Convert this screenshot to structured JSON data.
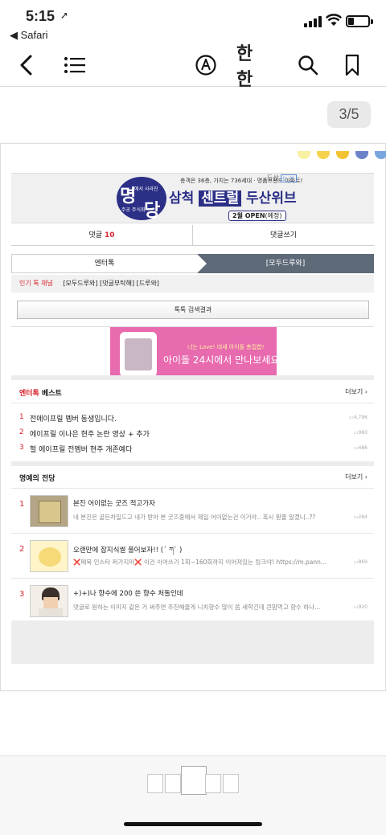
{
  "status_bar": {
    "time": "5:15",
    "back_app": "◀ Safari",
    "battery_percent": 25
  },
  "toolbar": {
    "reader_text": "한한"
  },
  "viewer": {
    "page_indicator": "3/5"
  },
  "ad": {
    "logo_big1": "명",
    "logo_big2": "당",
    "logo_small1": "에서 사라진",
    "logo_small2": "주공 주식회",
    "subtitle": "총객은 36층, 가치는 736세대 · 명품브랜드 아파트!",
    "title_pre": "삼척 ",
    "title_highlight": "센트럴",
    "title_post": " 두산위브",
    "open_badge": "2월 OPEN",
    "open_badge_note": "(예정)",
    "ad_mark": "두산"
  },
  "comment_tabs": {
    "comments_label": "댓글",
    "comments_count": "10",
    "write_comment": "댓글쓰기"
  },
  "category_tabs": {
    "left": "엔터톡",
    "right": "[모두드루와]"
  },
  "hot_channel": {
    "label": "인기 톡 채널",
    "channels": "[모두드루와] [댓글부탁해] [드루와]"
  },
  "search_results_button": "톡톡 검색결과",
  "promo": {
    "line1": "너는 Love! 대세 아이돌 총집합!",
    "line2": "아이돌 24시에서 만나보세요!"
  },
  "entertalk_best": {
    "title_red": "엔터톡",
    "title_rest": " 베스트",
    "more": "더보기 ›",
    "items": [
      {
        "num": "1",
        "text": "전에이프릴 멤버 동생입니다.",
        "comments": "4,796"
      },
      {
        "num": "2",
        "text": "에이프릴 이나은 현주 논란 영상 + 추가",
        "comments": "960"
      },
      {
        "num": "3",
        "text": "헐 에이프릴 전멤버 현주 개존예다",
        "comments": "486"
      }
    ]
  },
  "hall_of_fame": {
    "title": "명예의 전당",
    "more": "더보기 ›",
    "items": [
      {
        "num": "1",
        "title": "본진 어이없는 굿즈 적고가자",
        "desc": "내 본진은 골든차일드고 내가 받아 본 굿즈중에서 제일 어이없는건 이거야.. 혹시 뭔줄 알겠니..??",
        "comments": "284"
      },
      {
        "num": "2",
        "title": "오랜만에 잡지식썰 풀어보자!! (´ ཀ` )",
        "desc_x1": "❌",
        "desc_mid": "페북 인스타 퍼가지마",
        "desc_x2": "❌",
        "desc_rest": " 이건 이어쓰기 1회~160회까지 이어져있는 링크야! https://m.pann...",
        "comments": "869"
      },
      {
        "num": "3",
        "title": "+)+)나 향수에 200 쓴 향수 처돌인데",
        "desc": "댓글로 원하는 이미지 같은 거 써주면 추천해줄게 니치향수 많이 씀 새학긴데 큰맘먹고 향수 하나...",
        "comments": "920"
      }
    ]
  }
}
